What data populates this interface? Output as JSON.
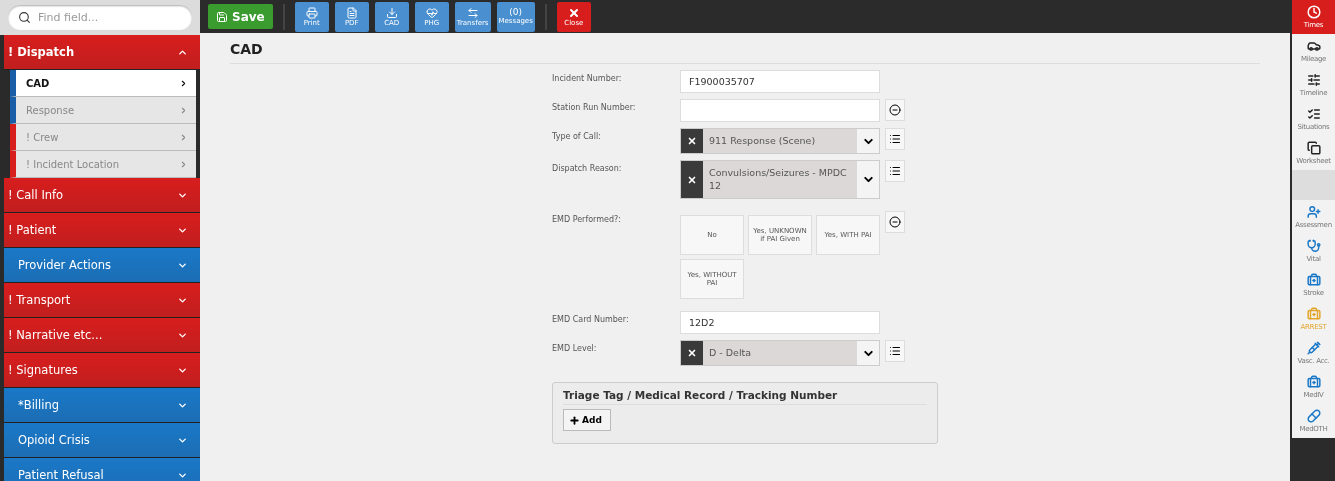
{
  "search": {
    "placeholder": "Find field..."
  },
  "toolbar": {
    "save": "Save",
    "buttons": [
      {
        "label": "Print",
        "kind": "print"
      },
      {
        "label": "PDF",
        "kind": "pdf"
      },
      {
        "label": "CAD",
        "kind": "cad"
      },
      {
        "label": "PHG",
        "kind": "phg"
      },
      {
        "label": "Transfers",
        "kind": "transfers"
      },
      {
        "label": "(0)",
        "caption": "Messages",
        "kind": "messages"
      }
    ],
    "close": "Close"
  },
  "sidebar": {
    "sections": [
      {
        "label": "! Dispatch",
        "color": "#d81d1d",
        "expanded": true,
        "children": [
          {
            "label": "CAD",
            "selected": true,
            "required": false
          },
          {
            "label": "Response",
            "selected": false,
            "required": false
          },
          {
            "label": "! Crew",
            "selected": false,
            "required": true
          },
          {
            "label": "! Incident Location",
            "selected": false,
            "required": true
          }
        ]
      },
      {
        "label": "! Call Info",
        "color": "#d81d1d",
        "expanded": false
      },
      {
        "label": "! Patient",
        "color": "#d81d1d",
        "expanded": false
      },
      {
        "label": "Provider Actions",
        "color": "#1a78c8",
        "expanded": false
      },
      {
        "label": "! Transport",
        "color": "#d81d1d",
        "expanded": false
      },
      {
        "label": "! Narrative etc...",
        "color": "#d81d1d",
        "expanded": false
      },
      {
        "label": "! Signatures",
        "color": "#d81d1d",
        "expanded": false
      },
      {
        "label": "*Billing",
        "color": "#1a78c8",
        "expanded": false
      },
      {
        "label": "Opioid Crisis",
        "color": "#1a78c8",
        "expanded": false
      },
      {
        "label": "Patient Refusal",
        "color": "#1a78c8",
        "expanded": false
      }
    ]
  },
  "page": {
    "title": "CAD",
    "fields": [
      {
        "label": "Incident Number:",
        "kind": "text",
        "value": "F1900035707",
        "minus_button": false,
        "list_button": false
      },
      {
        "label": "Station Run Number:",
        "kind": "text",
        "minus_button": true,
        "list_button": false
      },
      {
        "label": "Type of Call:",
        "kind": "select",
        "value": "911 Response (Scene)",
        "minus_button": false,
        "list_button": true
      },
      {
        "label": "Dispatch Reason:",
        "kind": "select",
        "value": "Convulsions/Seizures - MPDC 12",
        "minus_button": false,
        "list_button": true
      },
      {
        "label": "EMD Performed?:",
        "kind": "choice",
        "minus_button": true,
        "list_button": false,
        "options": [
          {
            "label": "No",
            "selected": false
          },
          {
            "label": "Yes, UNKNOWN if PAI Given",
            "selected": false
          },
          {
            "label": "Yes, WITH PAI",
            "selected": false
          },
          {
            "label": "Yes, WITHOUT PAI",
            "selected": false
          }
        ]
      },
      {
        "label": "EMD Card Number:",
        "kind": "text",
        "value": "12D2",
        "minus_button": false,
        "list_button": false
      },
      {
        "label": "EMD Level:",
        "kind": "select",
        "value": "D - Delta",
        "minus_button": false,
        "list_button": true
      }
    ],
    "panel": {
      "title": "Triage Tag / Medical Record / Tracking Number",
      "button": "Add"
    }
  },
  "rail": [
    {
      "label": "Times",
      "selected": true,
      "kind": "normal"
    },
    {
      "label": "Mileage",
      "selected": false,
      "kind": "normal"
    },
    {
      "label": "Timeline",
      "selected": false,
      "kind": "normal"
    },
    {
      "label": "Situations",
      "selected": false,
      "kind": "normal"
    },
    {
      "label": "Worksheet",
      "selected": false,
      "kind": "normal"
    },
    {
      "label": "Assessmen",
      "selected": false,
      "kind": "normal"
    },
    {
      "label": "Vital",
      "selected": false,
      "kind": "normal"
    },
    {
      "label": "Stroke",
      "selected": false,
      "kind": "normal"
    },
    {
      "label": "ARREST",
      "selected": false,
      "kind": "warning"
    },
    {
      "label": "Vasc. Acc.",
      "selected": false,
      "kind": "normal"
    },
    {
      "label": "MedIV",
      "selected": false,
      "kind": "normal"
    },
    {
      "label": "MedOTH",
      "selected": false,
      "kind": "normal"
    }
  ]
}
